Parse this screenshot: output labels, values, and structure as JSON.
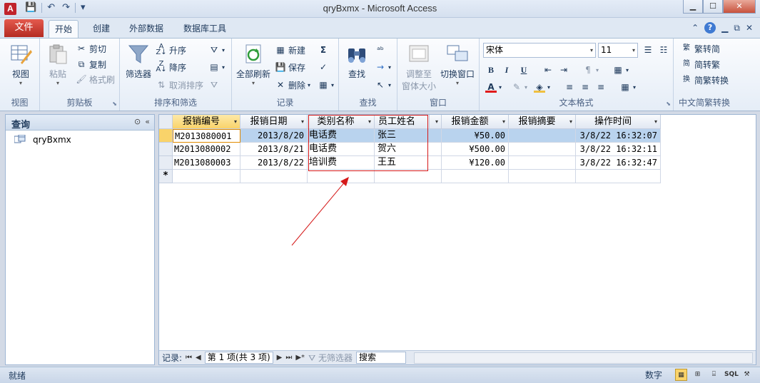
{
  "titlebar": {
    "app_icon": "A",
    "qat": {
      "save": "💾",
      "undo": "↶",
      "redo": "↷",
      "customize": "▾"
    },
    "title": "qryBxmx  -  Microsoft Access",
    "controls": {
      "minimize": "▁",
      "maximize": "☐",
      "close": "✕"
    }
  },
  "tabs": {
    "file": "文件",
    "items": [
      "开始",
      "创建",
      "外部数据",
      "数据库工具"
    ],
    "right": {
      "collapse": "⌃",
      "help": "?",
      "restore": "▭",
      "restore2": "⧉",
      "close": "✕"
    }
  },
  "ribbon": {
    "views": {
      "view_label": "视图",
      "group": "视图"
    },
    "clipboard": {
      "paste": "粘贴",
      "cut": "剪切",
      "copy": "复制",
      "format_painter": "格式刷",
      "group": "剪贴板"
    },
    "sort": {
      "filter": "筛选器",
      "asc": "升序",
      "desc": "降序",
      "clear": "取消排序",
      "group": "排序和筛选"
    },
    "records": {
      "refresh": "全部刷新",
      "new": "新建",
      "save": "保存",
      "delete": "删除",
      "totals": "Σ",
      "group": "记录"
    },
    "find": {
      "find": "查找",
      "replace": "ab→ac",
      "goto": "→",
      "select": "↖",
      "group": "查找"
    },
    "window": {
      "fit": "调整至\n窗体大小",
      "fit_l1": "调整至",
      "fit_l2": "窗体大小",
      "switch": "切换窗口",
      "group": "窗口"
    },
    "text": {
      "font": "宋体",
      "size": "11",
      "bold": "B",
      "italic": "I",
      "underline": "U",
      "group": "文本格式"
    },
    "chinese": {
      "t2s": "繁转简",
      "s2t": "简转繁",
      "convert": "简繁转换",
      "group": "中文简繁转换"
    }
  },
  "nav": {
    "header": "查询",
    "item": "qryBxmx"
  },
  "datasheet": {
    "columns": [
      "报销编号",
      "报销日期",
      "类别名称",
      "员工姓名",
      "",
      "报销金额",
      "报销摘要",
      "操作时间"
    ],
    "rows": [
      [
        "M2013080001",
        "2013/8/20",
        "电话费",
        "张三",
        "",
        "¥50.00",
        "",
        "3/8/22 16:32:07"
      ],
      [
        "M2013080002",
        "2013/8/21",
        "电话费",
        "贺六",
        "",
        "¥500.00",
        "",
        "3/8/22 16:32:11"
      ],
      [
        "M2013080003",
        "2013/8/22",
        "培训费",
        "王五",
        "",
        "¥120.00",
        "",
        "3/8/22 16:32:47"
      ]
    ],
    "new_row_marker": "*"
  },
  "recnav": {
    "label": "记录:",
    "first": "⏮",
    "prev": "◀",
    "position": "第 1 项(共 3 项)",
    "next": "▶",
    "last": "⏭",
    "new": "▶*",
    "filter": "无筛选器",
    "search": "搜索"
  },
  "status": {
    "left": "就绪",
    "numlock": "数字",
    "views": [
      "▦",
      "⊞",
      "⌸",
      "SQL",
      "⚒"
    ]
  },
  "colors": {
    "accent": "#f9d36a",
    "annotation": "#d51818",
    "file_tab": "#b42b22"
  }
}
